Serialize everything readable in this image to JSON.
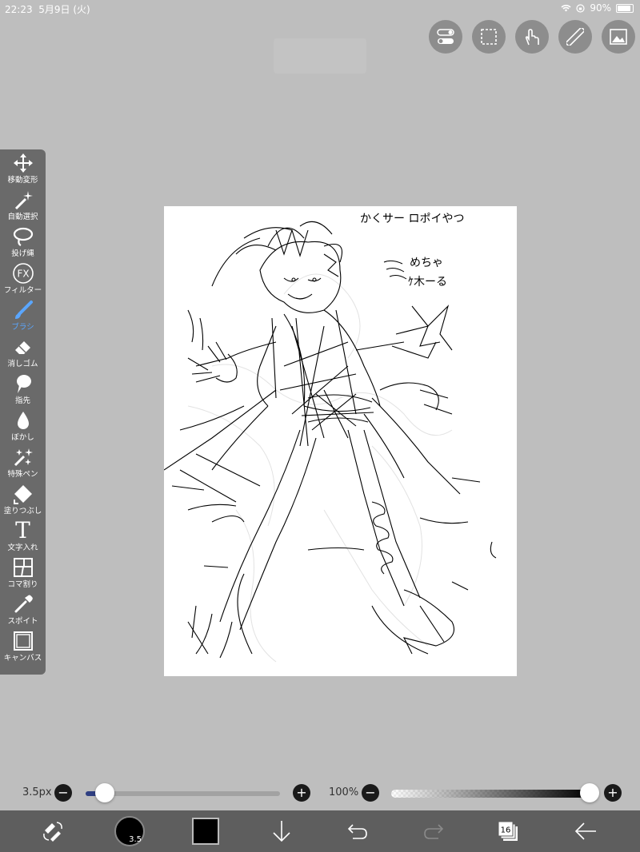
{
  "status_bar": {
    "time": "22:23",
    "date": "5月9日 (火)",
    "battery": "90%"
  },
  "top_tools": [
    "toggle-icon",
    "selection-icon",
    "touch-icon",
    "ruler-icon",
    "material-icon"
  ],
  "toolbar": {
    "items": [
      {
        "label": "移動変形",
        "icon": "move-icon"
      },
      {
        "label": "自動選択",
        "icon": "magic-wand-icon"
      },
      {
        "label": "投げ縄",
        "icon": "lasso-icon"
      },
      {
        "label": "フィルター",
        "icon": "fx-icon",
        "icon_text": "FX"
      },
      {
        "label": "ブラシ",
        "icon": "brush-icon",
        "active": true
      },
      {
        "label": "消しゴム",
        "icon": "eraser-icon"
      },
      {
        "label": "指先",
        "icon": "finger-icon"
      },
      {
        "label": "ぼかし",
        "icon": "blur-icon"
      },
      {
        "label": "特殊ペン",
        "icon": "special-pen-icon"
      },
      {
        "label": "塗りつぶし",
        "icon": "fill-icon"
      },
      {
        "label": "文字入れ",
        "icon": "text-icon",
        "icon_text": "T"
      },
      {
        "label": "コマ割り",
        "icon": "frame-divider-icon"
      },
      {
        "label": "スポイト",
        "icon": "eyedropper-icon"
      },
      {
        "label": "キャンバス",
        "icon": "canvas-icon"
      }
    ]
  },
  "canvas": {
    "annotation_top": "かくサー ロポイやつ",
    "annotation_mid1": "めちゃ",
    "annotation_mid2": "ｹ木ーる"
  },
  "brush_size": {
    "label": "3.5px",
    "value_fraction": 0.1,
    "minus": "−",
    "plus": "+"
  },
  "opacity": {
    "label": "100%",
    "value_fraction": 1.0,
    "minus": "−",
    "plus": "+"
  },
  "bottom_bar": {
    "brush_badge": "3.5",
    "layer_count": "16",
    "primary_color": "#000000",
    "accent_color": "#5aa6ff"
  }
}
